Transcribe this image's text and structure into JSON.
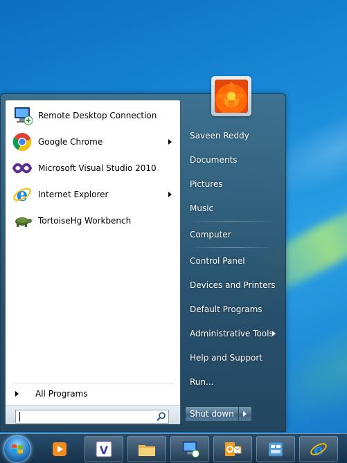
{
  "start_menu": {
    "pinned_programs": [
      {
        "label": "Remote Desktop Connection",
        "icon": "remote-desktop-icon",
        "has_submenu": false
      },
      {
        "label": "Google Chrome",
        "icon": "chrome-icon",
        "has_submenu": true
      },
      {
        "label": "Microsoft Visual Studio 2010",
        "icon": "visual-studio-icon",
        "has_submenu": false
      },
      {
        "label": "Internet Explorer",
        "icon": "internet-explorer-icon",
        "has_submenu": true
      },
      {
        "label": "TortoiseHg Workbench",
        "icon": "tortoisehg-icon",
        "has_submenu": false
      }
    ],
    "all_programs_label": "All Programs",
    "search": {
      "placeholder": "",
      "value": ""
    },
    "right_pane": [
      {
        "label": "Saveen Reddy",
        "has_submenu": false
      },
      {
        "label": "Documents",
        "has_submenu": false
      },
      {
        "label": "Pictures",
        "has_submenu": false
      },
      {
        "label": "Music",
        "has_submenu": false
      },
      {
        "label": "Computer",
        "has_submenu": false
      },
      {
        "label": "Control Panel",
        "has_submenu": false
      },
      {
        "label": "Devices and Printers",
        "has_submenu": false
      },
      {
        "label": "Default Programs",
        "has_submenu": false
      },
      {
        "label": "Administrative Tools",
        "has_submenu": true
      },
      {
        "label": "Help and Support",
        "has_submenu": false
      },
      {
        "label": "Run...",
        "has_submenu": false
      }
    ],
    "shutdown_label": "Shut down",
    "user_picture": "flower-avatar"
  },
  "taskbar": {
    "start_button": "windows-orb",
    "items": [
      {
        "icon": "media-player-icon",
        "active": false
      },
      {
        "icon": "visual-studio-icon",
        "active": true
      },
      {
        "icon": "file-explorer-icon",
        "active": true
      },
      {
        "icon": "remote-desktop-icon",
        "active": true
      },
      {
        "icon": "outlook-icon",
        "active": true
      },
      {
        "icon": "control-panel-icon",
        "active": true
      },
      {
        "icon": "internet-explorer-icon",
        "active": true
      }
    ]
  },
  "colors": {
    "accent": "#2a8fd6",
    "menu_right": "#3b6683",
    "taskbar": "#1c3a55"
  }
}
